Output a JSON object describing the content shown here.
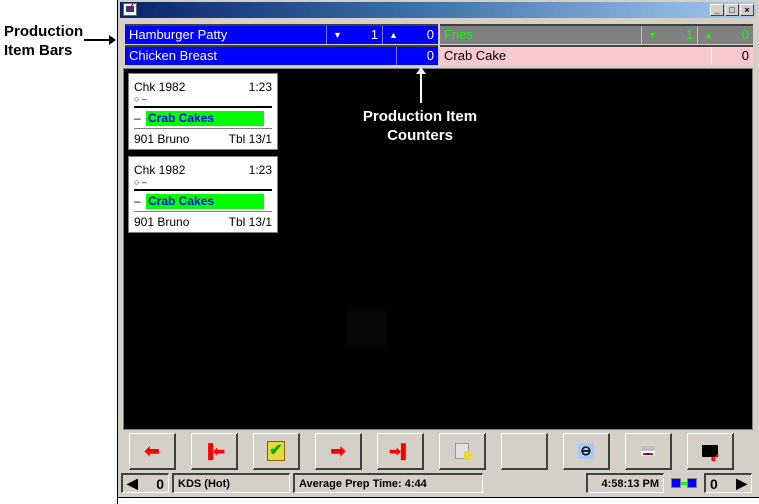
{
  "annotations": {
    "item_bars": "Production Item Bars",
    "item_counters": "Production Item Counters"
  },
  "window": {
    "icon": "kds-app-icon",
    "controls": [
      "_",
      "□",
      "×"
    ]
  },
  "production_bars": [
    {
      "name": "Hamburger Patty",
      "down_count": "1",
      "up_count": "0",
      "style": "blue",
      "color": "#0000ff"
    },
    {
      "name": "Chicken Breast",
      "count": "0",
      "style": "blue",
      "color": "#0000ff"
    },
    {
      "name": "Fries",
      "down_count": "1",
      "up_count": "0",
      "style": "gray",
      "color": "#808080",
      "text_color": "#00ff00"
    },
    {
      "name": "Crab Cake",
      "count": "0",
      "style": "pink",
      "color": "#f8c8d0"
    }
  ],
  "tickets": [
    {
      "check": "Chk 1982",
      "time": "1:23",
      "sub": "○ –",
      "item_prefix": "–",
      "item": "Crab Cakes",
      "server": "901 Bruno",
      "table": "Tbl 13/1"
    },
    {
      "check": "Chk 1982",
      "time": "1:23",
      "sub": "○ –",
      "item_prefix": "–",
      "item": "Crab Cakes",
      "server": "901 Bruno",
      "table": "Tbl 13/1"
    }
  ],
  "toolbar": {
    "buttons": [
      {
        "icon": "arrow-left-icon",
        "glyph": "🡄"
      },
      {
        "icon": "first-page-icon",
        "glyph": "❚❚🡄"
      },
      {
        "icon": "bump-check-icon",
        "glyph": "✔"
      },
      {
        "icon": "arrow-right-icon",
        "glyph": "🡆"
      },
      {
        "icon": "last-page-icon",
        "glyph": "🡆❚❚"
      },
      {
        "icon": "recall-icon",
        "glyph": "▤"
      },
      {
        "icon": "blank-icon",
        "glyph": ""
      },
      {
        "icon": "steering-wheel-icon",
        "glyph": "⊖"
      },
      {
        "icon": "display-settings-icon",
        "glyph": "▦"
      },
      {
        "icon": "exit-icon",
        "glyph": "▣"
      }
    ]
  },
  "statusbar": {
    "left_count": "0",
    "left_arrow": "◀",
    "station": "KDS (Hot)",
    "avg_prep": "Average Prep Time: 4:44",
    "time": "4:58:13 PM",
    "right_count": "0",
    "right_arrow": "▶"
  }
}
